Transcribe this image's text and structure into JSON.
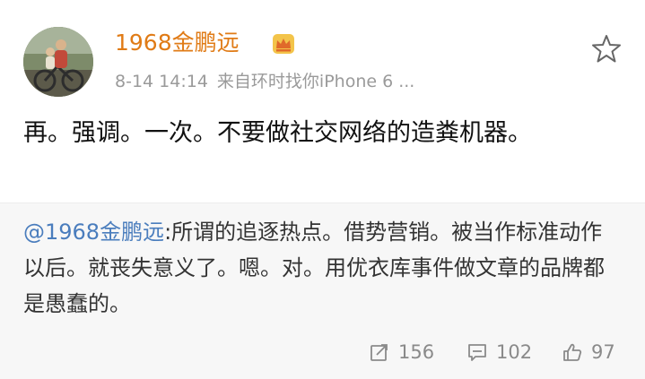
{
  "post": {
    "author": "1968金鹏远",
    "time": "8-14 14:14",
    "source": "来自环时找你iPhone 6 ...",
    "text": "再。强调。一次。不要做社交网络的造粪机器。",
    "star_icon": "star-outline-icon",
    "badge_icon": "crown-icon"
  },
  "repost": {
    "mention": "@1968金鹏远",
    "separator": ":",
    "text": "所谓的追逐热点。借势营销。被当作标准动作以后。就丧失意义了。嗯。对。用优衣库事件做文章的品牌都是愚蠢的。"
  },
  "actions": {
    "repost_count": "156",
    "comment_count": "102",
    "like_count": "97"
  },
  "colors": {
    "author": "#e07b16",
    "mention": "#4a7dbd",
    "meta": "#9a9a9a",
    "repost_bg": "#f7f7f7"
  }
}
